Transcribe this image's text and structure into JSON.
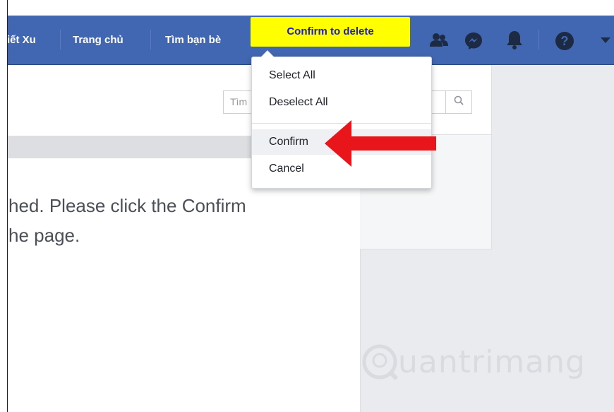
{
  "navbar": {
    "items": [
      {
        "label": "iết Xu"
      },
      {
        "label": "Trang chủ"
      },
      {
        "label": "Tìm bạn bè"
      }
    ],
    "confirm_button": "Confirm to delete",
    "icons": [
      "friends-icon",
      "messenger-icon",
      "bell-icon",
      "help-icon",
      "chevron-down-icon"
    ],
    "color": "#4267b2"
  },
  "search": {
    "placeholder": "Tìm"
  },
  "dropdown": {
    "items": [
      {
        "label": "Select All"
      },
      {
        "label": "Deselect All"
      },
      {
        "label": "Confirm"
      },
      {
        "label": "Cancel"
      }
    ],
    "highlighted": "Confirm"
  },
  "message": {
    "line1": "hed. Please click the Confirm",
    "line2": "he page."
  },
  "watermark": {
    "text": "uantrimang"
  },
  "annotation": {
    "arrow_color": "#e8151b"
  },
  "highlight_color": "#ffff00"
}
